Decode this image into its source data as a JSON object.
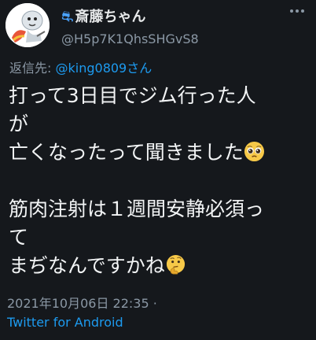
{
  "author": {
    "name_emoji": "⛐",
    "display_name": "斎藤ちゃん",
    "handle": "@H5p7K1QhsSHGvS8",
    "avatar_icon": "cartoon-character-avatar"
  },
  "reply": {
    "prefix": "返信先:",
    "mention": "@king0809さん"
  },
  "tweet": {
    "lines": [
      "打って3日目でジム行った人",
      "が",
      "亡くなったって聞きました",
      "",
      "筋肉注射は１週間安静必須っ",
      "て",
      "まぢなんですかね"
    ],
    "emoji_1": "pleading-face-icon",
    "emoji_2": "thinking-face-icon"
  },
  "meta": {
    "timestamp": "2021年10月06日 22:35 ·",
    "source": "Twitter for Android"
  },
  "colors": {
    "background": "#15181c",
    "text": "#e7e9ea",
    "muted": "#8b98a5",
    "link": "#1d9bf0"
  }
}
